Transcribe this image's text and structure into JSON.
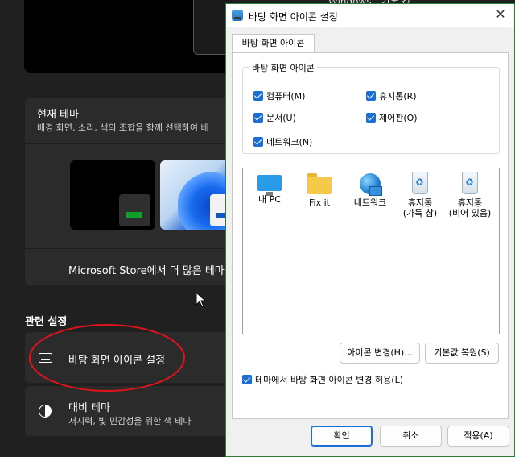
{
  "background": {
    "top_title": "Windows - 기본 값",
    "current_theme": {
      "title": "현재 테마",
      "subtitle": "배경 화면, 소리, 색의 조합을 함께 선택하여 배"
    },
    "store_link": "Microsoft Store에서 더 많은 테마",
    "related_settings": {
      "title": "관련 설정",
      "items": [
        {
          "label": "바탕 화면 아이콘 설정",
          "icon": "desktop-icon"
        },
        {
          "label": "대비 테마",
          "sub": "저시력, 빛 민감성을 위한 색 테마",
          "icon": "contrast-icon"
        }
      ]
    },
    "highlight_color": "#e0141b"
  },
  "dialog": {
    "title": "바탕 화면 아이콘 설정",
    "close_glyph": "✕",
    "tab": "바탕 화면 아이콘",
    "group_label": "바탕 화면 아이콘",
    "checkboxes": [
      {
        "label": "컴퓨터(M)",
        "checked": true
      },
      {
        "label": "휴지통(R)",
        "checked": true
      },
      {
        "label": "문서(U)",
        "checked": true
      },
      {
        "label": "제어판(O)",
        "checked": true
      },
      {
        "label": "네트워크(N)",
        "checked": true
      }
    ],
    "icons": [
      {
        "label": "내 PC",
        "icon": "monitor-icon"
      },
      {
        "label": "Fix it",
        "icon": "folder-icon"
      },
      {
        "label": "네트워크",
        "icon": "network-icon"
      },
      {
        "label": "휴지통\n(가득 참)",
        "icon": "recycle-bin-full-icon"
      },
      {
        "label": "휴지통\n(비어 있음)",
        "icon": "recycle-bin-empty-icon"
      }
    ],
    "change_icon_button": "아이콘 변경(H)...",
    "restore_default_button": "기본값 복원(S)",
    "allow_themes_checkbox": {
      "label": "테마에서 바탕 화면 아이콘 변경 허용(L)",
      "checked": true
    },
    "ok_button": "확인",
    "cancel_button": "취소",
    "apply_button": "적용(A)",
    "accent_color": "#1a6fd6"
  }
}
